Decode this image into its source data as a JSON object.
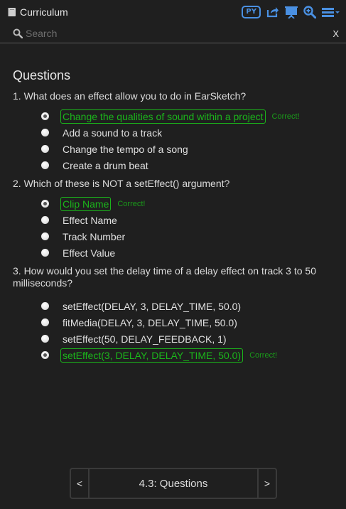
{
  "header": {
    "title": "Curriculum",
    "language_badge": "PY"
  },
  "search": {
    "placeholder": "Search",
    "close_label": "X"
  },
  "page": {
    "heading": "Questions"
  },
  "questions": [
    {
      "text": "1. What does an effect allow you to do in EarSketch?",
      "answers": [
        {
          "label": "Change the qualities of sound within a project",
          "checked": true,
          "correct": true,
          "feedback": "Correct!"
        },
        {
          "label": "Add a sound to a track"
        },
        {
          "label": "Change the tempo of a song"
        },
        {
          "label": "Create a drum beat"
        }
      ]
    },
    {
      "text": "2. Which of these is NOT a setEffect() argument?",
      "answers": [
        {
          "label": "Clip Name",
          "checked": true,
          "correct": true,
          "feedback": "Correct!"
        },
        {
          "label": "Effect Name"
        },
        {
          "label": "Track Number"
        },
        {
          "label": "Effect Value"
        }
      ]
    },
    {
      "text": "3. How would you set the delay time of a delay effect on track 3 to 50 milliseconds?",
      "answers": [
        {
          "label": "setEffect(DELAY, 3, DELAY_TIME, 50.0)"
        },
        {
          "label": "fitMedia(DELAY, 3, DELAY_TIME, 50.0)"
        },
        {
          "label": "setEffect(50, DELAY_FEEDBACK, 1)"
        },
        {
          "label": "setEffect(3, DELAY, DELAY_TIME, 50.0)",
          "checked": true,
          "correct": true,
          "feedback": "Correct!"
        }
      ]
    }
  ],
  "nav": {
    "prev": "<",
    "next": ">",
    "current": "4.3: Questions"
  },
  "colors": {
    "accent": "#4a90e2",
    "correct": "#1bb51b",
    "background": "#1f1f1f"
  }
}
